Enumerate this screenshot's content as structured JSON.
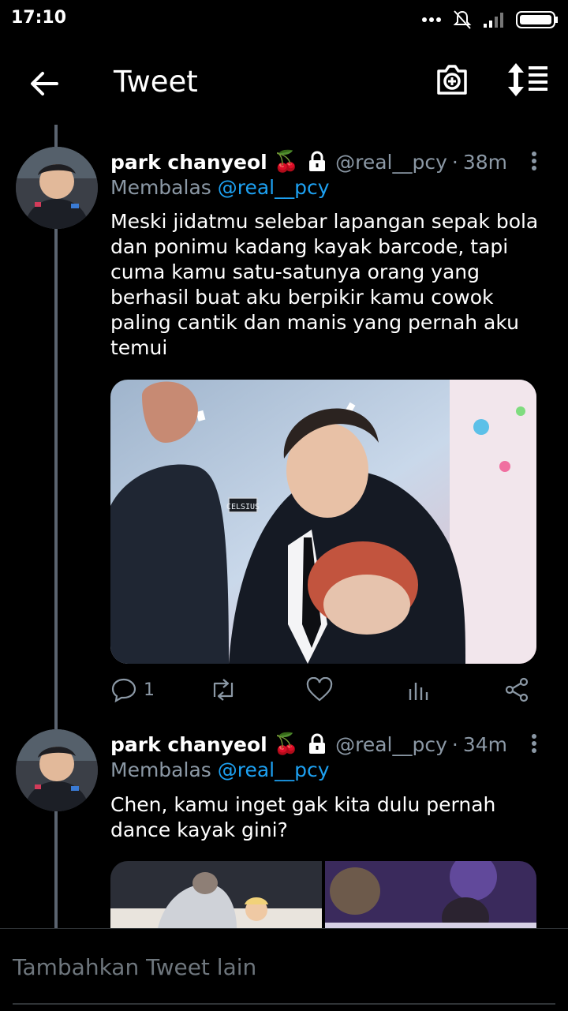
{
  "status_bar": {
    "time": "17:10"
  },
  "app_bar": {
    "title": "Tweet"
  },
  "tweets": [
    {
      "name": "park chanyeol",
      "emoji": "🍒",
      "handle": "@real__pcy",
      "time": "38m",
      "replying_label": "Membalas",
      "replying_to": "@real__pcy",
      "text": "Meski jidatmu selebar lapangan sepak bola dan ponimu kadang kayak barcode, tapi cuma kamu satu-satunya orang yang berhasil buat aku berpikir kamu cowok paling cantik dan manis yang  pernah aku temui",
      "media_watermark": "CELSIUS",
      "reply_count": "1"
    },
    {
      "name": "park chanyeol",
      "emoji": "🍒",
      "handle": "@real__pcy",
      "time": "34m",
      "replying_label": "Membalas",
      "replying_to": "@real__pcy",
      "text": "Chen, kamu inget gak kita dulu pernah dance kayak gini?"
    }
  ],
  "compose": {
    "placeholder": "Tambahkan Tweet lain"
  },
  "colors": {
    "accent": "#1da1f2",
    "muted": "#8b98a5",
    "background": "#000000"
  }
}
